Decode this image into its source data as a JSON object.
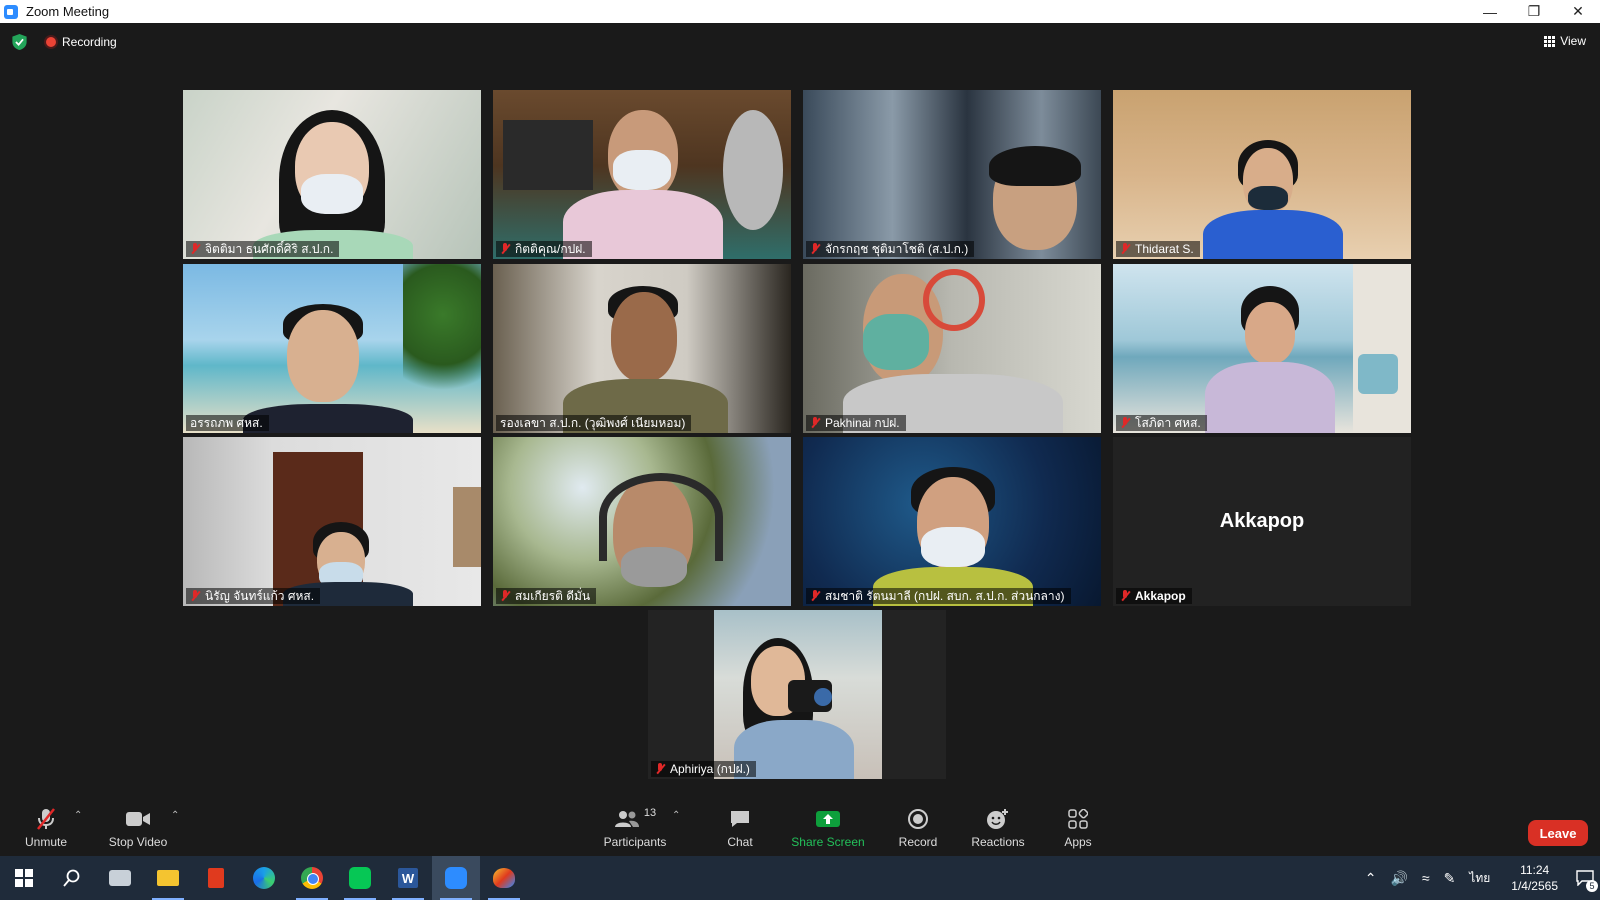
{
  "window": {
    "title": "Zoom Meeting"
  },
  "topbar": {
    "recording_label": "Recording",
    "view_label": "View"
  },
  "participants": [
    {
      "name": "จิตติมา  ธนศักดิ์ศิริ ส.ป.ก."
    },
    {
      "name": "กิตติคุณ/กปฝ."
    },
    {
      "name": "จักรกฤช ชุติมาโชติ (ส.ป.ก.)"
    },
    {
      "name": "Thidarat S."
    },
    {
      "name": "อรรถภพ ศหส."
    },
    {
      "name": "รองเลขา ส.ป.ก. (วุฒิพงศ์ เนียมหอม)"
    },
    {
      "name": "Pakhinai กปฝ."
    },
    {
      "name": "โสภิดา ศหส."
    },
    {
      "name": "นิรัญ จันทร์แก้ว ศหส."
    },
    {
      "name": "สมเกียรติ ดีมั่น"
    },
    {
      "name": "สมชาติ รัตนมาลี (กปฝ. สบก. ส.ป.ก. ส่วนกลาง)"
    },
    {
      "name": "Akkapop",
      "display_name": "Akkapop"
    },
    {
      "name": "Aphiriya (กปฝ.)"
    }
  ],
  "toolbar": {
    "unmute": "Unmute",
    "stop_video": "Stop Video",
    "participants": "Participants",
    "participants_count": "13",
    "chat": "Chat",
    "share_screen": "Share Screen",
    "record": "Record",
    "reactions": "Reactions",
    "apps": "Apps",
    "leave": "Leave"
  },
  "taskbar": {
    "time": "11:24",
    "date": "1/4/2565",
    "language": "ไทย",
    "notification_count": "5"
  },
  "colors": {
    "accent": "#2d8cff",
    "leave": "#d93025",
    "share": "#0e9f3c",
    "active_speaker": "#f4f18a"
  }
}
